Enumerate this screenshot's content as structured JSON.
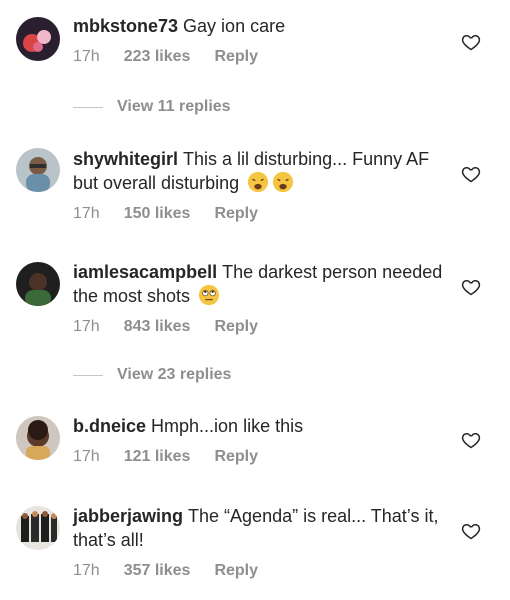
{
  "comments": [
    {
      "username": "mbkstone73",
      "text": "Gay ion care",
      "time": "17h",
      "likes": "223 likes",
      "reply": "Reply",
      "emoji": []
    },
    {
      "username": "shywhitegirl",
      "text": "This a lil disturbing... Funny AF but overall disturbing",
      "time": "17h",
      "likes": "150 likes",
      "reply": "Reply",
      "emoji": [
        "weary-face-emoji",
        "weary-face-emoji"
      ]
    },
    {
      "username": "iamlesacampbell",
      "text": "The darkest person needed the most shots",
      "time": "17h",
      "likes": "843 likes",
      "reply": "Reply",
      "emoji": [
        "eye-roll-emoji"
      ]
    },
    {
      "username": "b.dneice",
      "text": "Hmph...ion like this",
      "time": "17h",
      "likes": "121 likes",
      "reply": "Reply",
      "emoji": []
    },
    {
      "username": "jabberjawing",
      "text": "The “Agenda” is real... That’s it, that’s all!",
      "time": "17h",
      "likes": "357 likes",
      "reply": "Reply",
      "emoji": []
    }
  ],
  "view_replies": [
    {
      "label": "View 11 replies"
    },
    {
      "label": "View 23 replies"
    }
  ],
  "icons": {
    "like": "heart-outline-icon"
  },
  "colors": {
    "text": "#262626",
    "muted": "#8e8e8e",
    "divider": "#c7c7c7"
  }
}
